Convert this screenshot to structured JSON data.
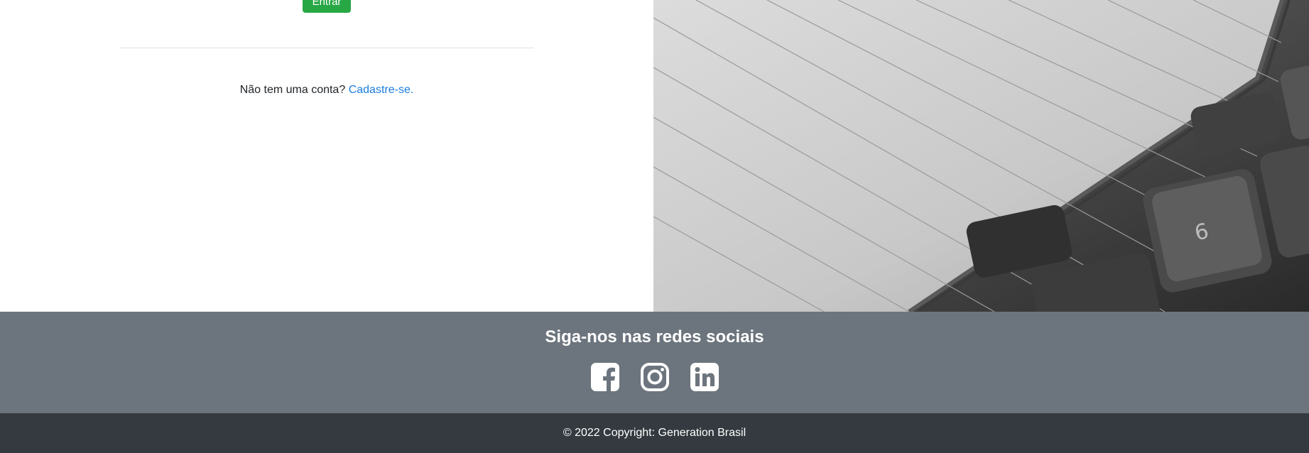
{
  "login": {
    "submit_label": "Entrar",
    "no_account_text": "Não tem uma conta?",
    "signup_link_label": "Cadastre-se."
  },
  "hero_image": {
    "subject": "notebook-on-keyboard-photo"
  },
  "footer": {
    "social_title": "Siga-nos nas redes sociais",
    "social_icons": [
      "facebook-icon",
      "instagram-icon",
      "linkedin-icon"
    ],
    "copyright": "© 2022 Copyright: Generation Brasil"
  },
  "colors": {
    "submit_button": "#28a745",
    "link": "#1a7de0",
    "footer_social_bg": "#6c757d",
    "footer_copy_bg": "#343a40"
  }
}
